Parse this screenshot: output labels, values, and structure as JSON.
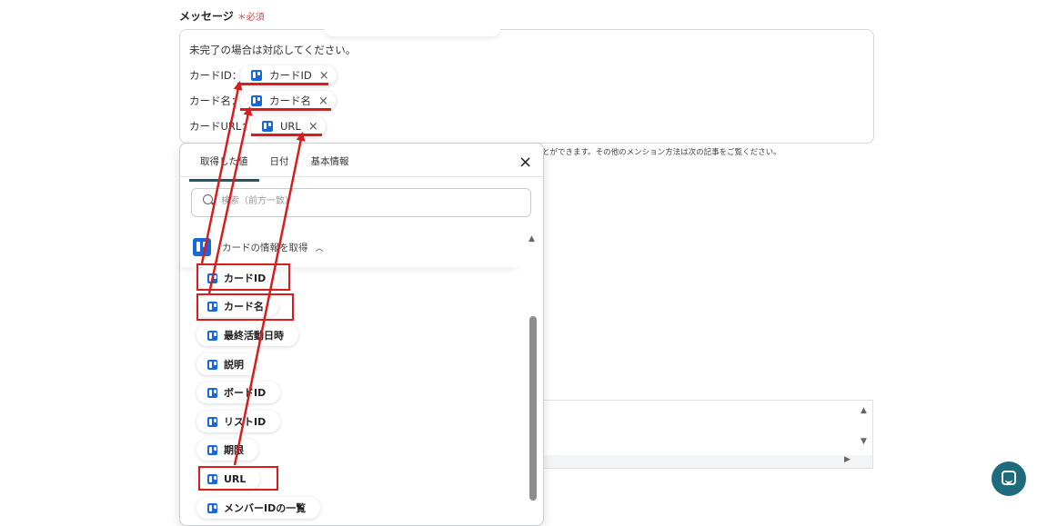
{
  "field": {
    "label": "メッセージ",
    "required": "＊必須"
  },
  "message": {
    "intro": "未完了の場合は対応してください。",
    "rows": [
      {
        "label": "カードID：",
        "chip": "カードID",
        "remove": "×"
      },
      {
        "label": "カード名：",
        "chip": "カード名",
        "remove": "×"
      },
      {
        "label": "カードURL：",
        "chip": "URL",
        "remove": "×"
      }
    ]
  },
  "helper_text": "とができます。その他のメンション方法は次の記事をご覧ください。",
  "panel": {
    "tabs": [
      "取得した値",
      "日付",
      "基本情報"
    ],
    "active_tab": "取得した値",
    "close": "×",
    "search_placeholder": "検索（前方一致）",
    "group": {
      "title": "カードの情報を取得",
      "caret": "^",
      "icon": "trello-icon"
    },
    "items": [
      "カードID",
      "カード名",
      "最終活動日時",
      "説明",
      "ボードID",
      "リストID",
      "期限",
      "URL",
      "メンバーIDの一覧"
    ],
    "highlighted_items": [
      "カードID",
      "カード名",
      "URL"
    ]
  },
  "colors": {
    "highlight": "#d91c1c",
    "accent_tab": "#27536b",
    "trello_blue": "#1868db",
    "chat_button": "#1f6b7e",
    "required": "#e0434b"
  }
}
